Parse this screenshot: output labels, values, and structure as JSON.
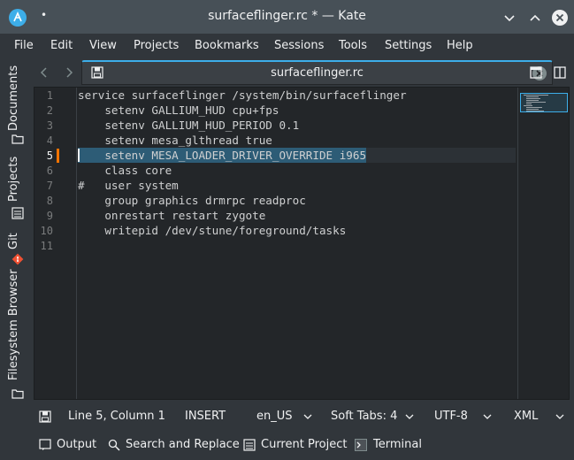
{
  "window": {
    "title": "surfaceflinger.rc * — Kate",
    "pin_glyph": "•",
    "icons": [
      "kate-icon",
      "minimize-icon",
      "maximize-icon",
      "close-icon"
    ]
  },
  "menu": [
    "File",
    "Edit",
    "View",
    "Projects",
    "Bookmarks",
    "Sessions",
    "Tools",
    "Settings",
    "Help"
  ],
  "tab": {
    "label": "surfaceflinger.rc"
  },
  "sidebar": {
    "items": [
      {
        "label": "Documents",
        "icon": "folder-icon"
      },
      {
        "label": "Projects",
        "icon": "projects-icon"
      },
      {
        "label": "Git",
        "icon": "git-icon"
      },
      {
        "label": "Filesystem Browser",
        "icon": "folder-icon"
      }
    ]
  },
  "editor": {
    "current_line": 5,
    "line_numbers": [
      "1",
      "2",
      "3",
      "4",
      "5",
      "6",
      "7",
      "8",
      "9",
      "10",
      "11"
    ],
    "lines": [
      "service surfaceflinger /system/bin/surfaceflinger",
      "    setenv GALLIUM_HUD cpu+fps",
      "    setenv GALLIUM_HUD_PERIOD 0.1",
      "    setenv mesa_glthread true",
      "    setenv MESA_LOADER_DRIVER_OVERRIDE i965",
      "    class core",
      "#   user system",
      "    group graphics drmrpc readproc",
      "    onrestart restart zygote",
      "    writepid /dev/stune/foreground/tasks",
      ""
    ]
  },
  "status": {
    "position": "Line 5, Column 1",
    "mode": "INSERT",
    "language": "en_US",
    "tabs": "Soft Tabs: 4",
    "encoding": "UTF-8",
    "syntax": "XML"
  },
  "toolviews": [
    {
      "label": "Output",
      "icon": "output-icon"
    },
    {
      "label": "Search and Replace",
      "icon": "search-icon"
    },
    {
      "label": "Current Project",
      "icon": "project-icon"
    },
    {
      "label": "Terminal",
      "icon": "terminal-icon"
    }
  ],
  "colors": {
    "accent": "#3daee9",
    "modified_marker": "#f67400",
    "selection": "#2d5c76",
    "git": "#f05133"
  }
}
